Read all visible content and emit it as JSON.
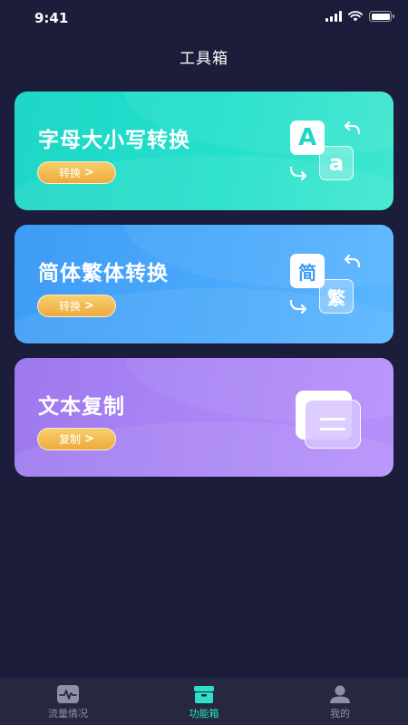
{
  "status_bar": {
    "time": "9:41",
    "battery_level": 1.0,
    "icons": [
      "cellular-signal-icon",
      "wifi-icon",
      "battery-icon"
    ]
  },
  "header": {
    "title": "工具箱"
  },
  "cards": [
    {
      "title": "字母大小写转换",
      "button_label": "转换",
      "illustration": {
        "back_glyph": "A",
        "front_glyph": "a",
        "icon": "letter-case-swap-icon"
      },
      "color": "#22e0cb"
    },
    {
      "title": "简体繁体转换",
      "button_label": "转换",
      "illustration": {
        "back_glyph": "简",
        "front_glyph": "繁",
        "icon": "chinese-script-swap-icon"
      },
      "color": "#4aa9fb"
    },
    {
      "title": "文本复制",
      "button_label": "复制",
      "illustration": {
        "icon": "copy-document-icon"
      },
      "color": "#ab87f6"
    }
  ],
  "button_chevron": ">",
  "tab_bar": {
    "tabs": [
      {
        "label": "流量情况",
        "icon": "traffic-chart-icon",
        "active": false
      },
      {
        "label": "功能箱",
        "icon": "toolbox-icon",
        "active": true
      },
      {
        "label": "我的",
        "icon": "user-profile-icon",
        "active": false
      }
    ],
    "active_color": "#2ee0c6",
    "inactive_color": "#8d90a6"
  }
}
